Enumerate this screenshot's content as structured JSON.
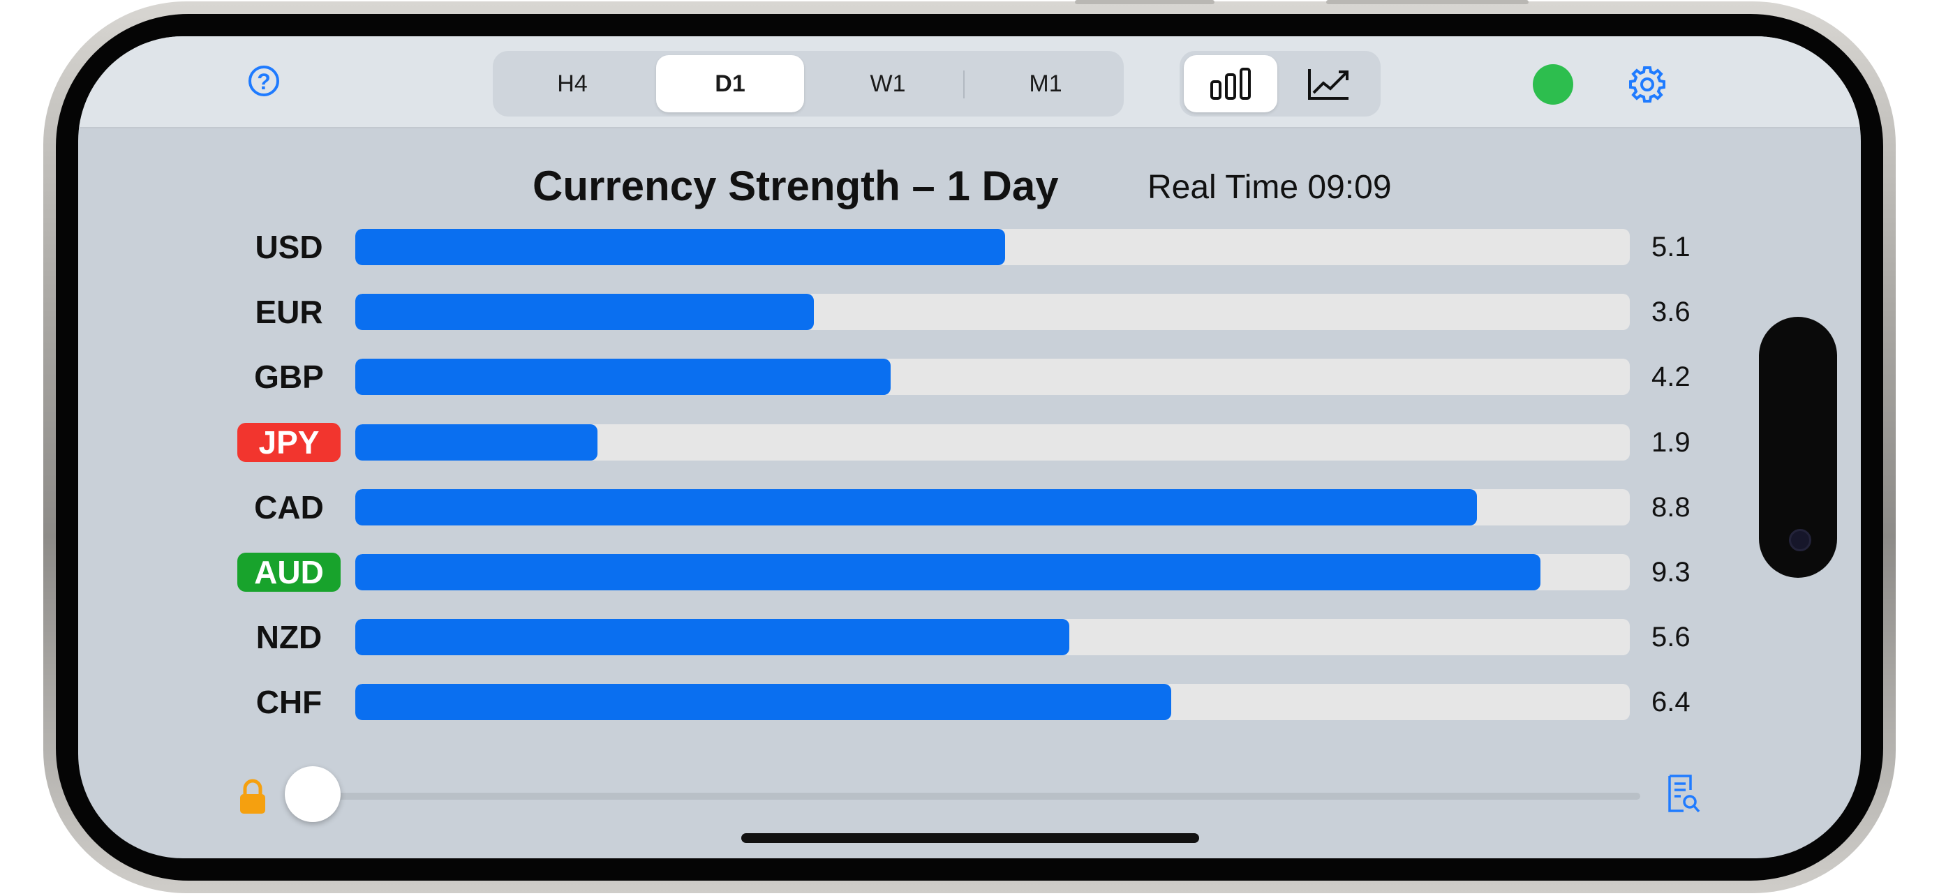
{
  "topbar": {
    "help_icon": "question-circle-icon",
    "timeframes": [
      {
        "label": "H4",
        "active": false
      },
      {
        "label": "D1",
        "active": true
      },
      {
        "label": "W1",
        "active": false
      },
      {
        "label": "M1",
        "active": false
      }
    ],
    "view_modes": [
      {
        "icon": "bar-chart-icon",
        "active": true
      },
      {
        "icon": "line-chart-icon",
        "active": false
      }
    ],
    "status_color": "#2dbe4e",
    "settings_icon": "gear-icon"
  },
  "header": {
    "title": "Currency Strength – 1 Day",
    "realtime": "Real Time 09:09"
  },
  "colors": {
    "bar": "#0a6ff0",
    "weakest_badge": "#f2352e",
    "strongest_badge": "#18a32c"
  },
  "chart_data": {
    "type": "bar",
    "orientation": "horizontal",
    "categories": [
      "USD",
      "EUR",
      "GBP",
      "JPY",
      "CAD",
      "AUD",
      "NZD",
      "CHF"
    ],
    "values": [
      5.1,
      3.6,
      4.2,
      1.9,
      8.8,
      9.3,
      5.6,
      6.4
    ],
    "value_labels": [
      "5.1",
      "3.6",
      "4.2",
      "1.9",
      "8.8",
      "9.3",
      "5.6",
      "6.4"
    ],
    "xlim": [
      0,
      10
    ],
    "highlight": {
      "JPY": "weakest",
      "AUD": "strongest"
    }
  },
  "footer": {
    "lock_icon": "lock-icon",
    "slider_value": 0,
    "doc_icon": "document-search-icon"
  }
}
